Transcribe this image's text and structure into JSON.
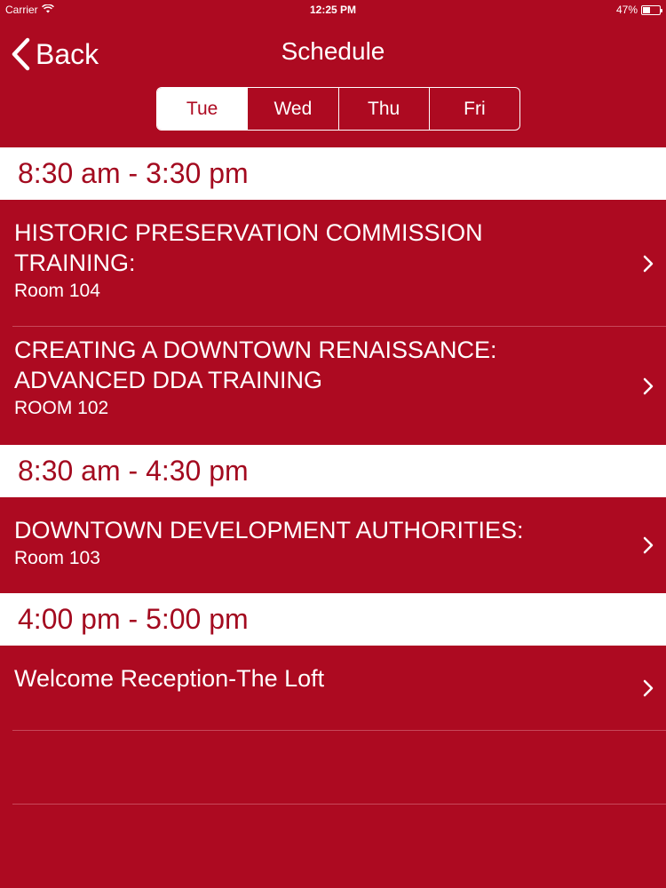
{
  "status_bar": {
    "carrier": "Carrier",
    "time": "12:25 PM",
    "battery_text": "47%",
    "battery_level": 0.47
  },
  "nav": {
    "back_label": "Back",
    "title": "Schedule"
  },
  "day_tabs": [
    {
      "label": "Tue",
      "selected": true
    },
    {
      "label": "Wed",
      "selected": false
    },
    {
      "label": "Thu",
      "selected": false
    },
    {
      "label": "Fri",
      "selected": false
    }
  ],
  "sections": [
    {
      "time_range": "8:30 am - 3:30 pm",
      "rows": [
        {
          "title": "HISTORIC PRESERVATION COMMISSION TRAINING:",
          "location": "Room 104"
        },
        {
          "title": "CREATING A DOWNTOWN RENAISSANCE: ADVANCED DDA TRAINING",
          "location": "ROOM 102"
        }
      ]
    },
    {
      "time_range": "8:30 am - 4:30 pm",
      "rows": [
        {
          "title": "DOWNTOWN DEVELOPMENT AUTHORITIES:",
          "location": "Room 103"
        }
      ]
    },
    {
      "time_range": "4:00 pm - 5:00 pm",
      "rows": [
        {
          "title": "Welcome Reception-The Loft",
          "location": ""
        }
      ]
    }
  ],
  "colors": {
    "background": "#ad0a21",
    "header_text": "#a30a1f",
    "foreground": "#ffffff"
  }
}
